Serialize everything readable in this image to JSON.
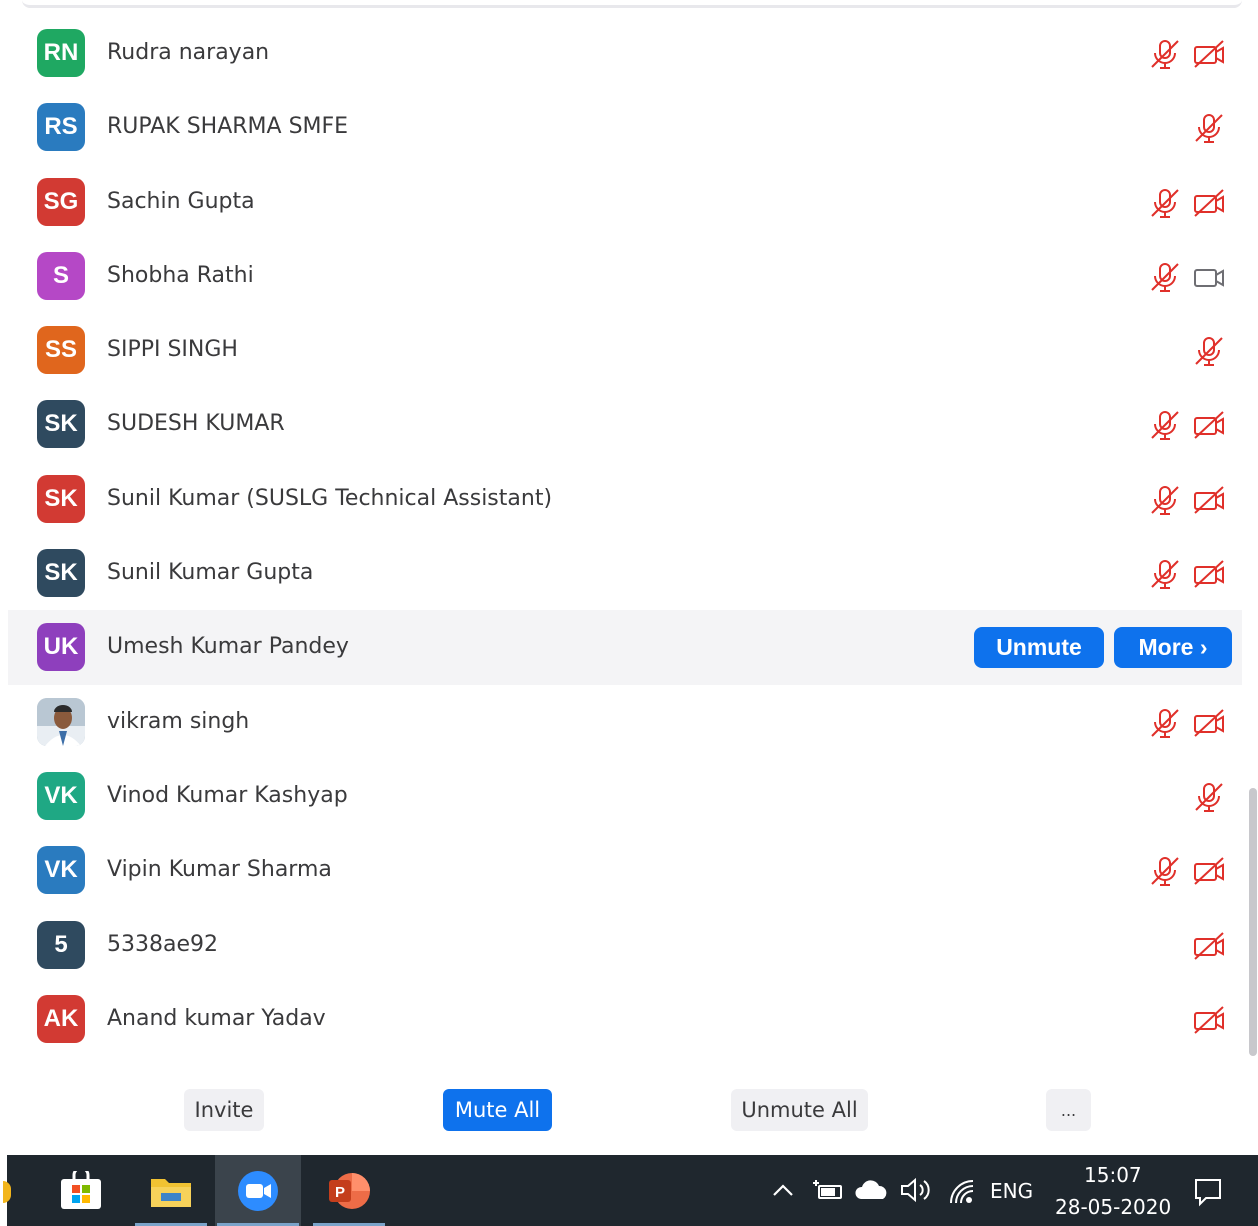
{
  "participants": [
    {
      "initials": "RN",
      "name": "Rudra narayan",
      "color": "#1fa862",
      "mic": "muted",
      "cam": "off"
    },
    {
      "initials": "RS",
      "name": "RUPAK SHARMA SMFE",
      "color": "#2a7bbf",
      "mic": "muted",
      "cam": "none"
    },
    {
      "initials": "SG",
      "name": "Sachin Gupta",
      "color": "#d23a33",
      "mic": "muted",
      "cam": "off"
    },
    {
      "initials": "S",
      "name": "Shobha Rathi",
      "color": "#b548c6",
      "mic": "muted",
      "cam": "on"
    },
    {
      "initials": "SS",
      "name": "SIPPI SINGH",
      "color": "#e0661d",
      "mic": "muted",
      "cam": "none"
    },
    {
      "initials": "SK",
      "name": "SUDESH KUMAR",
      "color": "#2f4a5f",
      "mic": "muted",
      "cam": "off"
    },
    {
      "initials": "SK",
      "name": "Sunil Kumar (SUSLG Technical Assistant)",
      "color": "#d23a33",
      "mic": "muted",
      "cam": "off"
    },
    {
      "initials": "SK",
      "name": "Sunil Kumar Gupta",
      "color": "#2f4a5f",
      "mic": "muted",
      "cam": "off"
    },
    {
      "initials": "UK",
      "name": "Umesh Kumar Pandey",
      "color": "#8e3fbd",
      "hovered": true
    },
    {
      "initials": "",
      "name": "vikram singh",
      "photo": true,
      "mic": "muted",
      "cam": "off"
    },
    {
      "initials": "VK",
      "name": "Vinod Kumar Kashyap",
      "color": "#1fa884",
      "mic": "none",
      "cam": "none",
      "single_mic": true
    },
    {
      "initials": "VK",
      "name": "Vipin Kumar Sharma",
      "color": "#2a7bbf",
      "mic": "muted",
      "cam": "off"
    },
    {
      "initials": "5",
      "name": "5338ae92",
      "color": "#2f4a5f",
      "mic": "none",
      "cam": "off"
    },
    {
      "initials": "AK",
      "name": "Anand kumar Yadav",
      "color": "#d23a33",
      "mic": "none",
      "cam": "off"
    }
  ],
  "row_actions": {
    "unmute_label": "Unmute",
    "more_label": "More ›"
  },
  "bottom_bar": {
    "invite": "Invite",
    "mute_all": "Mute All",
    "unmute_all": "Unmute All",
    "more": "..."
  },
  "taskbar": {
    "apps": [
      "microsoft-store",
      "file-explorer",
      "zoom",
      "powerpoint"
    ],
    "active_app": "zoom",
    "language": "ENG",
    "time": "15:07",
    "date": "28-05-2020"
  },
  "colors": {
    "accent": "#0e72ed",
    "muted_red": "#e0302a",
    "taskbar": "#1f272e"
  }
}
